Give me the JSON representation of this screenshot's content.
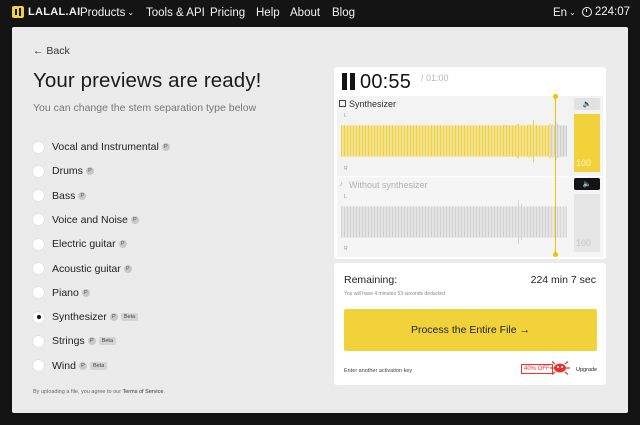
{
  "nav": {
    "logo": "LALAL.AI",
    "items": [
      {
        "label": "Products",
        "has_dropdown": true
      },
      {
        "label": "Tools & API",
        "has_dropdown": false
      },
      {
        "label": "Pricing",
        "has_dropdown": false
      },
      {
        "label": "Help",
        "has_dropdown": false
      },
      {
        "label": "About",
        "has_dropdown": false
      },
      {
        "label": "Blog",
        "has_dropdown": false
      }
    ],
    "language": "En",
    "credits": "224:07"
  },
  "page": {
    "back_label": "← Back",
    "title": "Your previews are ready!",
    "subtitle": "You can change the stem separation type below",
    "stems": [
      {
        "label": "Vocal and Instrumental",
        "badge": "P",
        "beta": false,
        "selected": false
      },
      {
        "label": "Drums",
        "badge": "P",
        "beta": false,
        "selected": false
      },
      {
        "label": "Bass",
        "badge": "P",
        "beta": false,
        "selected": false
      },
      {
        "label": "Voice and Noise",
        "badge": "P",
        "beta": false,
        "selected": false
      },
      {
        "label": "Electric guitar",
        "badge": "P",
        "beta": false,
        "selected": false
      },
      {
        "label": "Acoustic guitar",
        "badge": "P",
        "beta": false,
        "selected": false
      },
      {
        "label": "Piano",
        "badge": "P",
        "beta": false,
        "selected": false
      },
      {
        "label": "Synthesizer",
        "badge": "P",
        "beta": true,
        "selected": true
      },
      {
        "label": "Strings",
        "badge": "P",
        "beta": true,
        "selected": false
      },
      {
        "label": "Wind",
        "badge": "P",
        "beta": true,
        "selected": false
      }
    ],
    "beta_label": "Beta",
    "terms_prefix": "By uploading a file, you agree to our ",
    "terms_link": "Terms of Service",
    "terms_suffix": "."
  },
  "player": {
    "current_time": "00:55",
    "total_time": "/ 01:00",
    "tracks": [
      {
        "name": "Synthesizer",
        "volume": "100",
        "active": true,
        "left_label": "L",
        "right_label": "R"
      },
      {
        "name": "Without synthesizer",
        "volume": "100",
        "active": false,
        "left_label": "L",
        "right_label": "R"
      }
    ],
    "playhead_fraction": 0.92
  },
  "remaining": {
    "label": "Remaining:",
    "value": "224 min 7 sec",
    "note": "You will have 4 minutes 53 seconds deducted",
    "process_button": "Process the Entire File →",
    "activation_link": "Enter another activation key",
    "discount_badge": "40% OFF",
    "upgrade_link": "Upgrade"
  },
  "colors": {
    "accent_yellow": "#f2d23a",
    "dark": "#141414",
    "panel_bg": "#ebebeb",
    "discount_red": "#e33333"
  }
}
